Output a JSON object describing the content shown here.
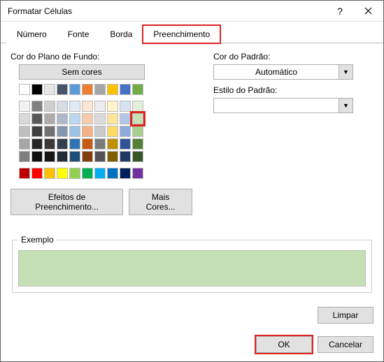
{
  "window": {
    "title": "Formatar Células"
  },
  "tabs": {
    "t0": "Número",
    "t1": "Fonte",
    "t2": "Borda",
    "t3": "Preenchimento",
    "active": 3
  },
  "labels": {
    "bgcolor": "Cor do Plano de Fundo:",
    "nocolor": "Sem cores",
    "fillfx": "Efeitos de Preenchimento...",
    "morecolors": "Mais Cores...",
    "patterncolor": "Cor do Padrão:",
    "patternstyle": "Estilo do Padrão:",
    "auto": "Automático",
    "example": "Exemplo",
    "clear": "Limpar",
    "ok": "OK",
    "cancel": "Cancelar"
  },
  "example_color": "#c5e0b4",
  "palette": {
    "row0": [
      "#ffffff",
      "#000000",
      "#e7e6e6",
      "#44546a",
      "#5b9bd5",
      "#ed7d31",
      "#a5a5a5",
      "#ffc000",
      "#4472c4",
      "#70ad47"
    ],
    "row1": [
      "#f2f2f2",
      "#808080",
      "#d0cece",
      "#d6dce4",
      "#deebf6",
      "#fbe5d5",
      "#ededed",
      "#fff2cc",
      "#d9e2f3",
      "#e2efd9"
    ],
    "row2": [
      "#d9d9d9",
      "#595959",
      "#aeabab",
      "#adb9ca",
      "#bdd7ee",
      "#f7cbac",
      "#dbdbdb",
      "#fee599",
      "#b4c6e7",
      "#c5e0b4"
    ],
    "row3": [
      "#bfbfbf",
      "#404040",
      "#757070",
      "#8496b0",
      "#9cc3e5",
      "#f4b183",
      "#c9c9c9",
      "#ffd965",
      "#8eaadb",
      "#a8d08d"
    ],
    "row4": [
      "#a6a6a6",
      "#262626",
      "#3a3838",
      "#323f4f",
      "#2e75b5",
      "#c55a11",
      "#7b7b7b",
      "#bf9000",
      "#2f5496",
      "#538135"
    ],
    "row5": [
      "#7f7f7f",
      "#0d0d0d",
      "#171616",
      "#222a35",
      "#1e4e79",
      "#833c0b",
      "#525252",
      "#7f6000",
      "#1f3864",
      "#375623"
    ],
    "std": [
      "#c00000",
      "#ff0000",
      "#ffc000",
      "#ffff00",
      "#92d050",
      "#00b050",
      "#00b0f0",
      "#0070c0",
      "#002060",
      "#7030a0"
    ],
    "selected": "r2c9"
  }
}
